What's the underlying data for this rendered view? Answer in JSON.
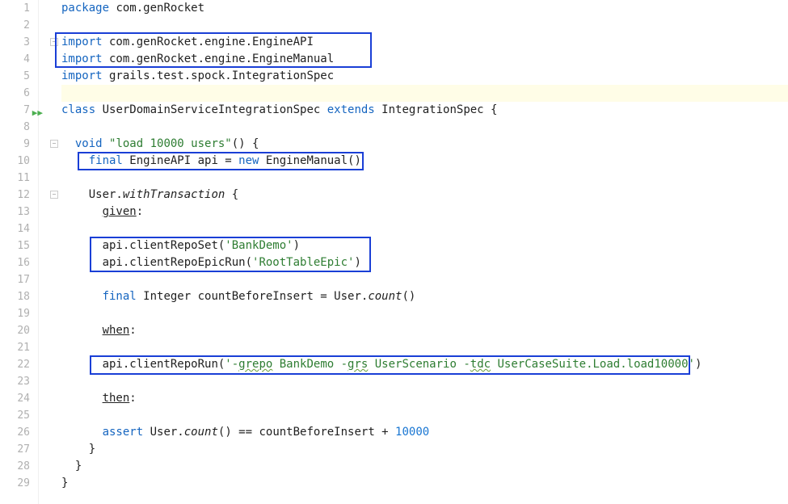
{
  "gutter": {
    "lines": [
      "1",
      "2",
      "3",
      "4",
      "5",
      "6",
      "7",
      "8",
      "9",
      "10",
      "11",
      "12",
      "13",
      "14",
      "15",
      "16",
      "17",
      "18",
      "19",
      "20",
      "21",
      "22",
      "23",
      "24",
      "25",
      "26",
      "27",
      "28",
      "29"
    ]
  },
  "code": {
    "l1_kw": "package",
    "l1_pkg": " com.genRocket",
    "l3_kw": "import",
    "l3_imp": " com.genRocket.engine.EngineAPI",
    "l4_kw": "import",
    "l4_imp": " com.genRocket.engine.EngineManual",
    "l5_kw": "import",
    "l5_imp": " grails.test.spock.IntegrationSpec",
    "l7_kw1": "class",
    "l7_cls": " UserDomainServiceIntegrationSpec ",
    "l7_kw2": "extends",
    "l7_ext": " IntegrationSpec {",
    "l9_kw": "void",
    "l9_sp": " ",
    "l9_str": "\"load 10000 users\"",
    "l9_rest": "() {",
    "l10_kw1": "final",
    "l10_m": " EngineAPI api = ",
    "l10_kw2": "new",
    "l10_r": " EngineManual()",
    "l12_a": "User.",
    "l12_b": "withTransaction",
    "l12_c": " {",
    "l13_label": "given",
    "l13_colon": ":",
    "l15_a": "api.clientRepoSet(",
    "l15_str": "'BankDemo'",
    "l15_b": ")",
    "l16_a": "api.clientRepoEpicRun(",
    "l16_str": "'RootTableEpic'",
    "l16_b": ")",
    "l18_kw": "final",
    "l18_a": " Integer countBeforeInsert = User.",
    "l18_b": "count",
    "l18_c": "()",
    "l20_label": "when",
    "l20_colon": ":",
    "l22_a": "api.clientRepoRun(",
    "l22_s1": "'-",
    "l22_wavy": "grepo",
    "l22_s2": " BankDemo -",
    "l22_wavy2": "grs",
    "l22_s3": " UserScenario -",
    "l22_wavy3": "tdc",
    "l22_s4": " UserCaseSuite.Load.load10000'",
    "l22_b": ")",
    "l24_label": "then",
    "l24_colon": ":",
    "l26_kw": "assert",
    "l26_a": " User.",
    "l26_b": "count",
    "l26_c": "() == countBeforeInsert + ",
    "l26_num": "10000",
    "l27": "}",
    "l28": "}",
    "l29": "}"
  },
  "indent": {
    "i0": "",
    "i2": "  ",
    "i4": "    ",
    "i6": "      ",
    "i8": "        "
  }
}
